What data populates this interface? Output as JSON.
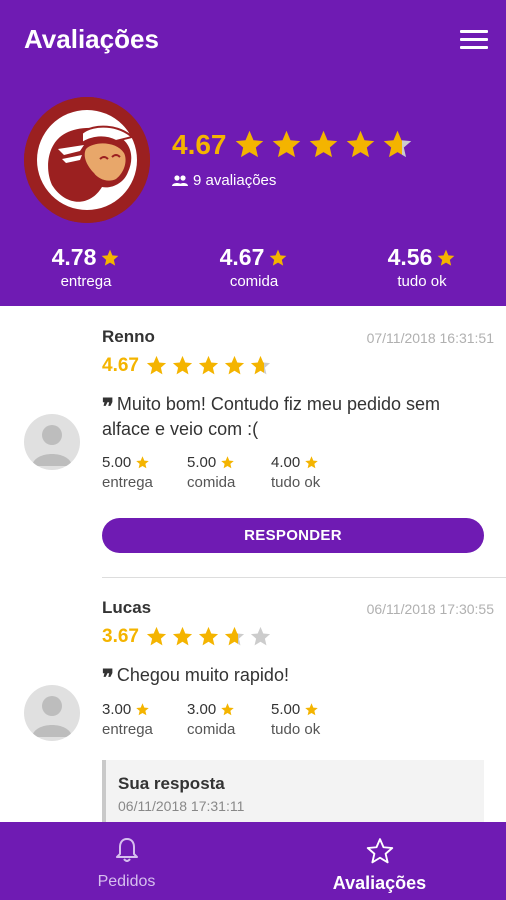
{
  "header": {
    "title": "Avaliações",
    "overall_rating": "4.67",
    "overall_stars": 4.67,
    "reviews_count": "9 avaliações",
    "subratings": [
      {
        "value": "4.78",
        "label": "entrega"
      },
      {
        "value": "4.67",
        "label": "comida"
      },
      {
        "value": "4.56",
        "label": "tudo ok"
      }
    ]
  },
  "reviews": [
    {
      "name": "Renno",
      "date": "07/11/2018 16:31:51",
      "rating": "4.67",
      "stars": 4.67,
      "comment": "Muito bom! Contudo fiz meu pedido sem alface e veio com :(",
      "subratings": [
        {
          "value": "5.00",
          "label": "entrega"
        },
        {
          "value": "5.00",
          "label": "comida"
        },
        {
          "value": "4.00",
          "label": "tudo ok"
        }
      ],
      "button": "RESPONDER"
    },
    {
      "name": "Lucas",
      "date": "06/11/2018 17:30:55",
      "rating": "3.67",
      "stars": 3.67,
      "comment": "Chegou muito rapido!",
      "subratings": [
        {
          "value": "3.00",
          "label": "entrega"
        },
        {
          "value": "3.00",
          "label": "comida"
        },
        {
          "value": "5.00",
          "label": "tudo ok"
        }
      ],
      "reply": {
        "title": "Sua resposta",
        "date": "06/11/2018 17:31:11"
      }
    }
  ],
  "bottom_nav": [
    {
      "label": "Pedidos",
      "icon": "bell-icon",
      "active": false
    },
    {
      "label": "Avaliações",
      "icon": "star-outline-icon",
      "active": true
    }
  ],
  "colors": {
    "primary": "#6f1bb3",
    "star": "#f4b400",
    "star_empty": "#cccccc",
    "logo_red": "#9b2020"
  }
}
